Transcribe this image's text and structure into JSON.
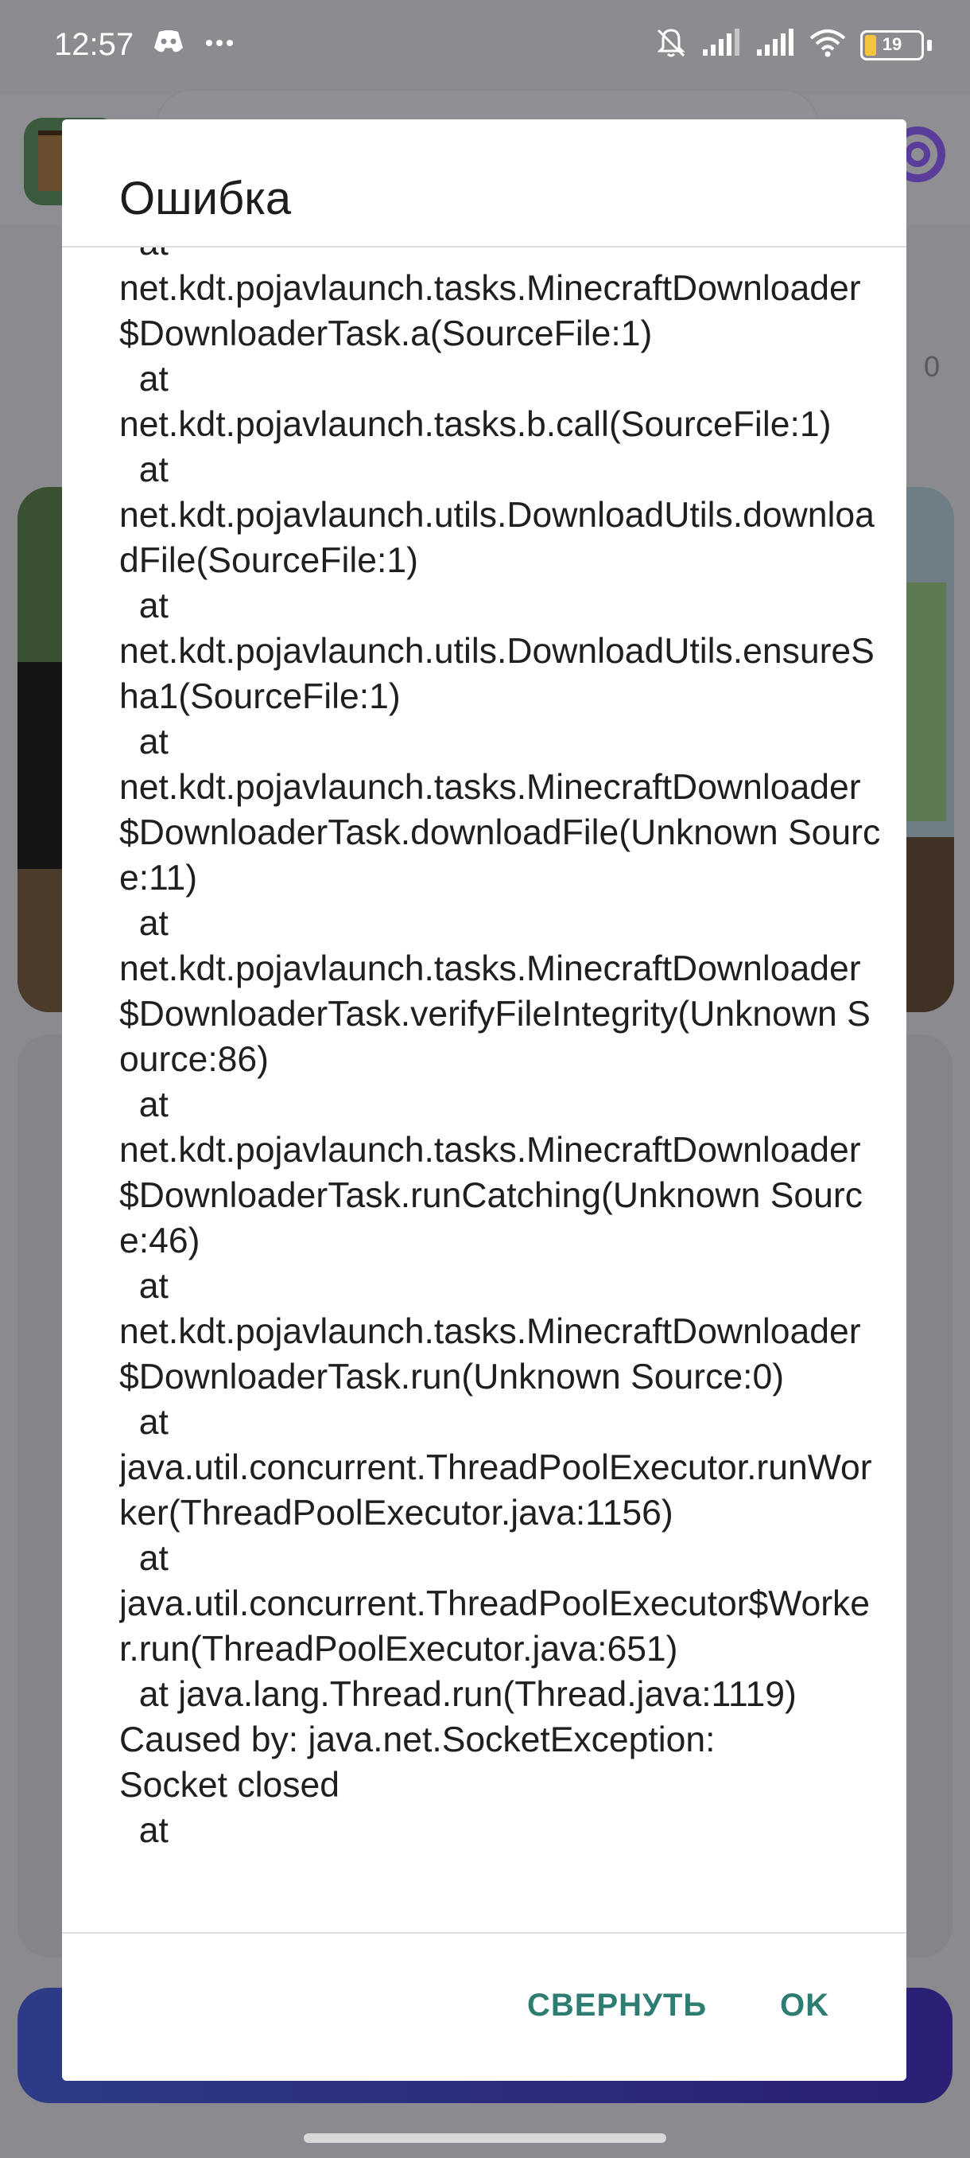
{
  "status_bar": {
    "time": "12:57",
    "left_icons": [
      "discord-icon",
      "more-icon"
    ],
    "right_icons": [
      "mute-icon",
      "signal-icon",
      "signal-icon",
      "wifi-icon"
    ],
    "battery_level": "19"
  },
  "background": {
    "side_number": "0"
  },
  "dialog": {
    "title": "Ошибка",
    "message": "  at\nnet.kdt.pojavlaunch.tasks.MinecraftDownloader$DownloaderTask.a(SourceFile:1)\n  at\nnet.kdt.pojavlaunch.tasks.b.call(SourceFile:1)\n  at\nnet.kdt.pojavlaunch.utils.DownloadUtils.downloadFile(SourceFile:1)\n  at\nnet.kdt.pojavlaunch.utils.DownloadUtils.ensureSha1(SourceFile:1)\n  at\nnet.kdt.pojavlaunch.tasks.MinecraftDownloader$DownloaderTask.downloadFile(Unknown Source:11)\n  at\nnet.kdt.pojavlaunch.tasks.MinecraftDownloader$DownloaderTask.verifyFileIntegrity(Unknown Source:86)\n  at\nnet.kdt.pojavlaunch.tasks.MinecraftDownloader$DownloaderTask.runCatching(Unknown Source:46)\n  at\nnet.kdt.pojavlaunch.tasks.MinecraftDownloader$DownloaderTask.run(Unknown Source:0)\n  at\njava.util.concurrent.ThreadPoolExecutor.runWorker(ThreadPoolExecutor.java:1156)\n  at\njava.util.concurrent.ThreadPoolExecutor$Worker.run(ThreadPoolExecutor.java:651)\n  at java.lang.Thread.run(Thread.java:1119)\nCaused by: java.net.SocketException:\nSocket closed\n  at",
    "buttons": {
      "collapse": "СВЕРНУТЬ",
      "ok": "OK"
    }
  },
  "colors": {
    "accent": "#2e7d73",
    "scrim": "#8a8a8f",
    "dialog_bg": "#ffffff"
  }
}
